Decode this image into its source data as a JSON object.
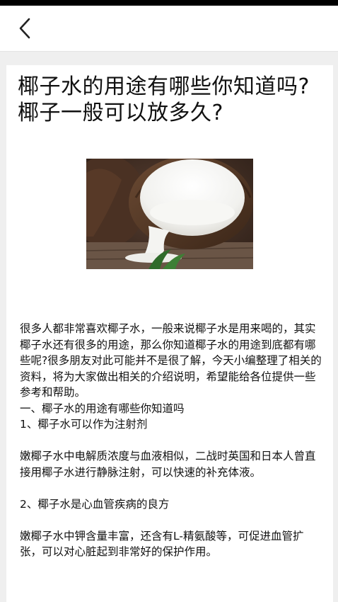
{
  "nav": {
    "back_icon": "chevron-left-icon"
  },
  "article": {
    "title": "椰子水的用途有哪些你知道吗?椰子一般可以放多久?",
    "image_alt": "coconut-photo",
    "intro": "很多人都非常喜欢椰子水，一般来说椰子水是用来喝的，其实椰子水还有很多的用途，那么你知道椰子水的用途到底都有哪些呢?很多朋友对此可能并不是很了解，今天小编整理了相关的资料，将为大家做出相关的介绍说明，希望能给各位提供一些参考和帮助。",
    "section1_heading": "一、椰子水的用途有哪些你知道吗",
    "item1_heading": "1、椰子水可以作为注射剂",
    "item1_body": "嫩椰子水中电解质浓度与血液相似，二战时英国和日本人曾直接用椰子水进行静脉注射，可以快速的补充体液。",
    "item2_heading": "2、椰子水是心血管疾病的良方",
    "item2_body": "嫩椰子水中钾含量丰富，还含有L-精氨酸等，可促进血管扩张，可以对心脏起到非常好的保护作用。"
  }
}
